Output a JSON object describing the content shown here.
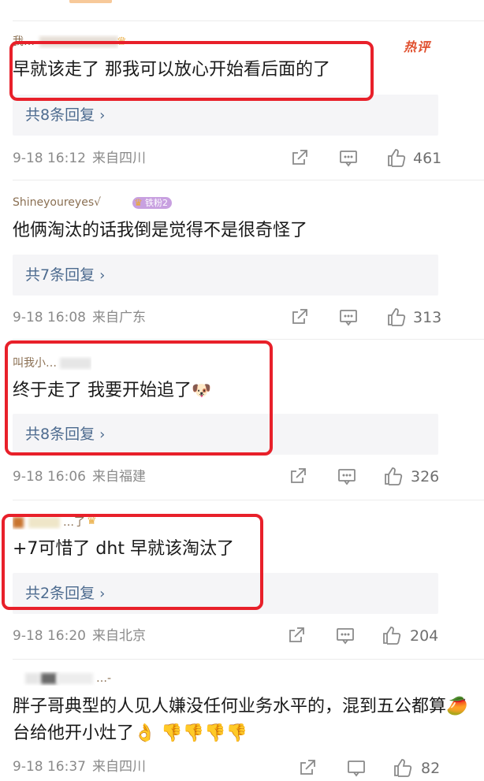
{
  "colors": {
    "accent_highlight": "#e8202a",
    "link": "#4d6b8f",
    "meta": "#8a8a8a",
    "hot": "#e0502f"
  },
  "comments": [
    {
      "username": "我…",
      "hot_label": "热评",
      "text": "早就该走了 那我可以放心开始看后面的了",
      "reply_summary": "共8条回复",
      "date": "9-18 16:12",
      "location": "来自四川",
      "likes": "461"
    },
    {
      "username": "Shineyoureyes√",
      "badge": "铁粉2",
      "text": "他俩淘汰的话我倒是觉得不是很奇怪了",
      "reply_summary": "共7条回复",
      "date": "9-18 16:08",
      "location": "来自广东",
      "likes": "313"
    },
    {
      "username": "叫我小…",
      "text": "终于走了 我要开始追了",
      "reply_summary": "共8条回复",
      "date": "9-18 16:06",
      "location": "来自福建",
      "likes": "326"
    },
    {
      "username": "…了",
      "text": "+7可惜了 dht 早就该淘汰了",
      "reply_summary": "共2条回复",
      "date": "9-18 16:20",
      "location": "来自北京",
      "likes": "204"
    },
    {
      "username": "…-",
      "text": "胖子哥典型的人见人嫌没任何业务水平的，混到五公都算🥭台给他开小灶了👌 👎👎👎👎",
      "date": "9-18 16:37",
      "location": "来自四川",
      "likes": "82"
    }
  ],
  "icons": {
    "share": "share-icon",
    "comment": "comment-icon",
    "like": "thumbs-up-icon",
    "chevron": "chevron-right-icon",
    "crown": "crown-icon"
  }
}
